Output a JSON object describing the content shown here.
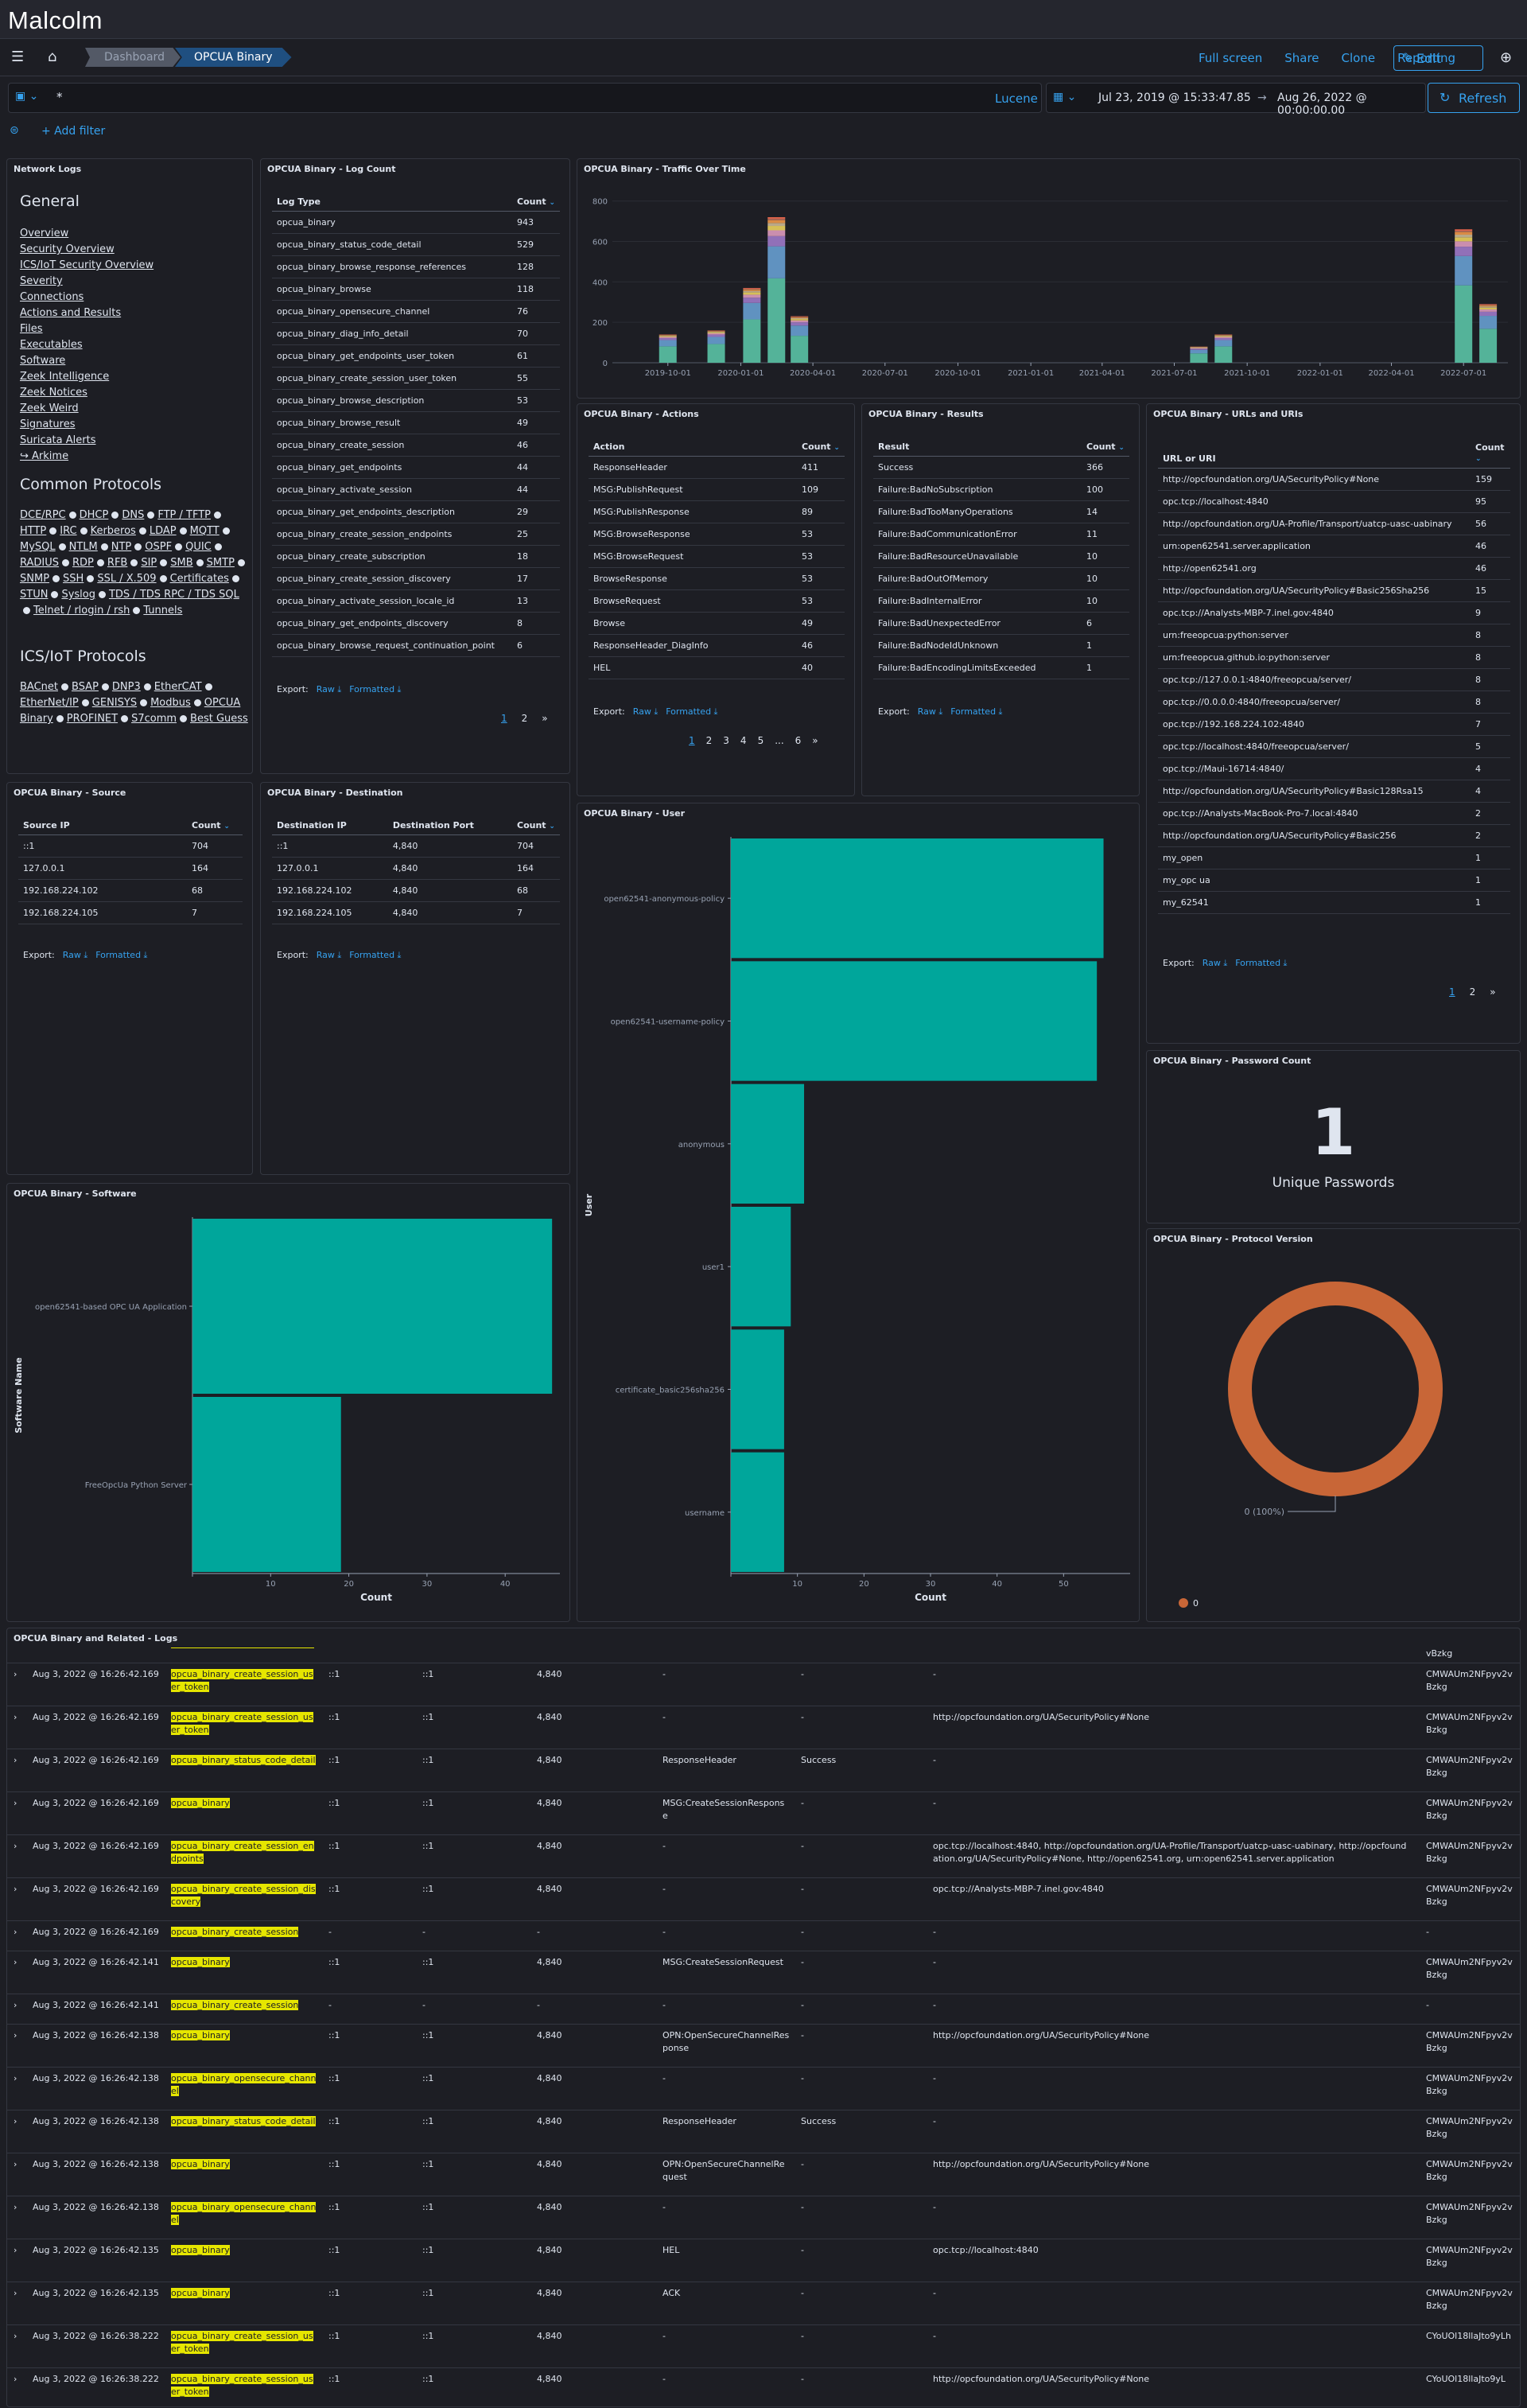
{
  "app": {
    "logo": "Malcolm"
  },
  "breadcrumbs": [
    "Dashboard",
    "OPCUA Binary"
  ],
  "top_links": [
    "Full screen",
    "Share",
    "Clone",
    "Reporting"
  ],
  "edit_label": "Edit",
  "query": {
    "type_icon": "calendar-db-icon",
    "text": "*",
    "language": "Lucene"
  },
  "time": {
    "start": "Jul 23, 2019 @ 15:33:47.85",
    "arrow": "→",
    "end": "Aug 26, 2022 @ 00:00:00.00",
    "refresh": "Refresh"
  },
  "add_filter": "+ Add filter",
  "network_logs": {
    "title": "Network Logs",
    "general_heading": "General",
    "general": [
      "Overview",
      "Security Overview",
      "ICS/IoT Security Overview",
      "Severity",
      "Connections",
      "Actions and Results",
      "Files",
      "Executables",
      "Software",
      "Zeek Intelligence",
      "Zeek Notices",
      "Zeek Weird",
      "Signatures",
      "Suricata Alerts",
      "↪ Arkime"
    ],
    "common_heading": "Common Protocols",
    "common": [
      "DCE/RPC",
      "DHCP",
      "DNS",
      "FTP / TFTP",
      "HTTP",
      "IRC",
      "Kerberos",
      "LDAP",
      "MQTT",
      "MySQL",
      "NTLM",
      "NTP",
      "OSPF",
      "QUIC",
      "RADIUS",
      "RDP",
      "RFB",
      "SIP",
      "SMB",
      "SMTP",
      "SNMP",
      "SSH",
      "SSL / X.509",
      "Certificates",
      "STUN",
      "Syslog",
      "TDS / TDS RPC / TDS SQL",
      "Telnet / rlogin / rsh",
      "Tunnels"
    ],
    "ics_heading": "ICS/IoT Protocols",
    "ics": [
      "BACnet",
      "BSAP",
      "DNP3",
      "EtherCAT",
      "EtherNet/IP",
      "GENISYS",
      "Modbus",
      "OPCUA Binary",
      "PROFINET",
      "S7comm",
      "Best Guess"
    ]
  },
  "log_count": {
    "title": "OPCUA Binary - Log Count",
    "headers": [
      "Log Type",
      "Count"
    ],
    "rows": [
      [
        "opcua_binary",
        "943"
      ],
      [
        "opcua_binary_status_code_detail",
        "529"
      ],
      [
        "opcua_binary_browse_response_references",
        "128"
      ],
      [
        "opcua_binary_browse",
        "118"
      ],
      [
        "opcua_binary_opensecure_channel",
        "76"
      ],
      [
        "opcua_binary_diag_info_detail",
        "70"
      ],
      [
        "opcua_binary_get_endpoints_user_token",
        "61"
      ],
      [
        "opcua_binary_create_session_user_token",
        "55"
      ],
      [
        "opcua_binary_browse_description",
        "53"
      ],
      [
        "opcua_binary_browse_result",
        "49"
      ],
      [
        "opcua_binary_create_session",
        "46"
      ],
      [
        "opcua_binary_get_endpoints",
        "44"
      ],
      [
        "opcua_binary_activate_session",
        "44"
      ],
      [
        "opcua_binary_get_endpoints_description",
        "29"
      ],
      [
        "opcua_binary_create_session_endpoints",
        "25"
      ],
      [
        "opcua_binary_create_subscription",
        "18"
      ],
      [
        "opcua_binary_create_session_discovery",
        "17"
      ],
      [
        "opcua_binary_activate_session_locale_id",
        "13"
      ],
      [
        "opcua_binary_get_endpoints_discovery",
        "8"
      ],
      [
        "opcua_binary_browse_request_continuation_point",
        "6"
      ]
    ],
    "pages": [
      "1",
      "2",
      "»"
    ]
  },
  "export": {
    "label": "Export:",
    "raw": "Raw",
    "formatted": "Formatted"
  },
  "traffic": {
    "title": "OPCUA Binary - Traffic Over Time"
  },
  "chart_data": [
    {
      "type": "bar",
      "title": "OPCUA Binary - Traffic Over Time",
      "stacked": true,
      "x_ticks": [
        "2019-10-01",
        "2020-01-01",
        "2020-04-01",
        "2020-07-01",
        "2020-10-01",
        "2021-01-01",
        "2021-04-01",
        "2021-07-01",
        "2021-10-01",
        "2022-01-01",
        "2022-04-01",
        "2022-07-01"
      ],
      "y_ticks": [
        "0",
        "200",
        "400",
        "600",
        "800"
      ],
      "ylim": [
        0,
        850
      ],
      "bars": [
        {
          "x": "2019-10-01",
          "total": 140
        },
        {
          "x": "2019-12-01",
          "total": 160
        },
        {
          "x": "2020-01-15",
          "total": 370
        },
        {
          "x": "2020-02-15",
          "total": 720
        },
        {
          "x": "2020-03-15",
          "total": 230
        },
        {
          "x": "2021-08-01",
          "total": 80
        },
        {
          "x": "2021-09-01",
          "total": 140
        },
        {
          "x": "2022-07-01",
          "total": 660
        },
        {
          "x": "2022-08-01",
          "total": 290
        }
      ]
    },
    {
      "type": "bar",
      "orientation": "horizontal",
      "title": "OPCUA Binary - User",
      "ylabel": "User",
      "xlabel": "Count",
      "categories": [
        "open62541-anonymous-policy",
        "open62541-username-policy",
        "anonymous",
        "user1",
        "certificate_basic256sha256",
        "username"
      ],
      "values": [
        56,
        55,
        11,
        9,
        8,
        8
      ],
      "x_ticks": [
        "0",
        "10",
        "20",
        "30",
        "40",
        "50"
      ],
      "xlim": [
        0,
        60
      ],
      "color": "#00a69b"
    },
    {
      "type": "bar",
      "orientation": "horizontal",
      "title": "OPCUA Binary - Software",
      "ylabel": "Software Name",
      "xlabel": "Count",
      "categories": [
        "open62541-based OPC UA Application",
        "FreeOpcUa Python Server"
      ],
      "values": [
        46,
        19
      ],
      "x_ticks": [
        "0",
        "10",
        "20",
        "30",
        "40"
      ],
      "xlim": [
        0,
        47
      ],
      "color": "#00a69b"
    },
    {
      "type": "pie",
      "title": "OPCUA Binary - Protocol Version",
      "donut": true,
      "slices": [
        {
          "label": "0",
          "value": 100,
          "color": "#c86637"
        }
      ],
      "slice_label": "0 (100%)",
      "legend": [
        "0"
      ]
    }
  ],
  "actions": {
    "title": "OPCUA Binary - Actions",
    "headers": [
      "Action",
      "Count"
    ],
    "rows": [
      [
        "ResponseHeader",
        "411"
      ],
      [
        "MSG:PublishRequest",
        "109"
      ],
      [
        "MSG:PublishResponse",
        "89"
      ],
      [
        "MSG:BrowseResponse",
        "53"
      ],
      [
        "MSG:BrowseRequest",
        "53"
      ],
      [
        "BrowseResponse",
        "53"
      ],
      [
        "BrowseRequest",
        "53"
      ],
      [
        "Browse",
        "49"
      ],
      [
        "ResponseHeader_DiagInfo",
        "46"
      ],
      [
        "HEL",
        "40"
      ]
    ],
    "pages": [
      "1",
      "2",
      "3",
      "4",
      "5",
      "...",
      "6",
      "»"
    ]
  },
  "results": {
    "title": "OPCUA Binary - Results",
    "headers": [
      "Result",
      "Count"
    ],
    "rows": [
      [
        "Success",
        "366"
      ],
      [
        "Failure:BadNoSubscription",
        "100"
      ],
      [
        "Failure:BadTooManyOperations",
        "14"
      ],
      [
        "Failure:BadCommunicationError",
        "11"
      ],
      [
        "Failure:BadResourceUnavailable",
        "10"
      ],
      [
        "Failure:BadOutOfMemory",
        "10"
      ],
      [
        "Failure:BadInternalError",
        "10"
      ],
      [
        "Failure:BadUnexpectedError",
        "6"
      ],
      [
        "Failure:BadNodeIdUnknown",
        "1"
      ],
      [
        "Failure:BadEncodingLimitsExceeded",
        "1"
      ]
    ]
  },
  "urls": {
    "title": "OPCUA Binary - URLs and URIs",
    "headers": [
      "URL or URI",
      "Count"
    ],
    "rows": [
      [
        "http://opcfoundation.org/UA/SecurityPolicy#None",
        "159"
      ],
      [
        "opc.tcp://localhost:4840",
        "95"
      ],
      [
        "http://opcfoundation.org/UA-Profile/Transport/uatcp-uasc-uabinary",
        "56"
      ],
      [
        "urn:open62541.server.application",
        "46"
      ],
      [
        "http://open62541.org",
        "46"
      ],
      [
        "http://opcfoundation.org/UA/SecurityPolicy#Basic256Sha256",
        "15"
      ],
      [
        "opc.tcp://Analysts-MBP-7.inel.gov:4840",
        "9"
      ],
      [
        "urn:freeopcua:python:server",
        "8"
      ],
      [
        "urn:freeopcua.github.io:python:server",
        "8"
      ],
      [
        "opc.tcp://127.0.0.1:4840/freeopcua/server/",
        "8"
      ],
      [
        "opc.tcp://0.0.0.0:4840/freeopcua/server/",
        "8"
      ],
      [
        "opc.tcp://192.168.224.102:4840",
        "7"
      ],
      [
        "opc.tcp://localhost:4840/freeopcua/server/",
        "5"
      ],
      [
        "opc.tcp://Maui-16714:4840/",
        "4"
      ],
      [
        "http://opcfoundation.org/UA/SecurityPolicy#Basic128Rsa15",
        "4"
      ],
      [
        "opc.tcp://Analysts-MacBook-Pro-7.local:4840",
        "2"
      ],
      [
        "http://opcfoundation.org/UA/SecurityPolicy#Basic256",
        "2"
      ],
      [
        "my_open",
        "1"
      ],
      [
        "my_opc ua",
        "1"
      ],
      [
        "my_62541",
        "1"
      ]
    ],
    "pages": [
      "1",
      "2",
      "»"
    ]
  },
  "source": {
    "title": "OPCUA Binary - Source",
    "headers": [
      "Source IP",
      "Count"
    ],
    "rows": [
      [
        "::1",
        "704"
      ],
      [
        "127.0.0.1",
        "164"
      ],
      [
        "192.168.224.102",
        "68"
      ],
      [
        "192.168.224.105",
        "7"
      ]
    ]
  },
  "destination": {
    "title": "OPCUA Binary - Destination",
    "headers": [
      "Destination IP",
      "Destination Port",
      "Count"
    ],
    "rows": [
      [
        "::1",
        "4,840",
        "704"
      ],
      [
        "127.0.0.1",
        "4,840",
        "164"
      ],
      [
        "192.168.224.102",
        "4,840",
        "68"
      ],
      [
        "192.168.224.105",
        "4,840",
        "7"
      ]
    ]
  },
  "user": {
    "title": "OPCUA Binary - User"
  },
  "password": {
    "title": "OPCUA Binary - Password Count",
    "value": "1",
    "label": "Unique Passwords"
  },
  "protocol": {
    "title": "OPCUA Binary - Protocol Version"
  },
  "software": {
    "title": "OPCUA Binary - Software"
  },
  "logs": {
    "title": "OPCUA Binary and Related - Logs",
    "rows": [
      {
        "time": "",
        "type": "",
        "src": "",
        "dst": "",
        "port": "",
        "action": "",
        "result": "",
        "uri": "",
        "uid": "vBzkg"
      },
      {
        "time": "Aug 3, 2022 @ 16:26:42.169",
        "type": "opcua_binary_create_session_user_token",
        "src": "::1",
        "dst": "::1",
        "port": "4,840",
        "action": "-",
        "result": "-",
        "uri": "-",
        "uid": "CMWAUm2NFpyv2vBzkg"
      },
      {
        "time": "Aug 3, 2022 @ 16:26:42.169",
        "type": "opcua_binary_create_session_user_token",
        "src": "::1",
        "dst": "::1",
        "port": "4,840",
        "action": "-",
        "result": "-",
        "uri": "http://opcfoundation.org/UA/SecurityPolicy#None",
        "uid": "CMWAUm2NFpyv2vBzkg"
      },
      {
        "time": "Aug 3, 2022 @ 16:26:42.169",
        "type": "opcua_binary_status_code_detail",
        "src": "::1",
        "dst": "::1",
        "port": "4,840",
        "action": "ResponseHeader",
        "result": "Success",
        "uri": "-",
        "uid": "CMWAUm2NFpyv2vBzkg"
      },
      {
        "time": "Aug 3, 2022 @ 16:26:42.169",
        "type": "opcua_binary",
        "src": "::1",
        "dst": "::1",
        "port": "4,840",
        "action": "MSG:CreateSessionResponse",
        "result": "-",
        "uri": "-",
        "uid": "CMWAUm2NFpyv2vBzkg"
      },
      {
        "time": "Aug 3, 2022 @ 16:26:42.169",
        "type": "opcua_binary_create_session_endpoints",
        "src": "::1",
        "dst": "::1",
        "port": "4,840",
        "action": "-",
        "result": "-",
        "uri": "opc.tcp://localhost:4840, http://opcfoundation.org/UA-Profile/Transport/uatcp-uasc-uabinary, http://opcfoundation.org/UA/SecurityPolicy#None, http://open62541.org, urn:open62541.server.application",
        "uid": "CMWAUm2NFpyv2vBzkg"
      },
      {
        "time": "Aug 3, 2022 @ 16:26:42.169",
        "type": "opcua_binary_create_session_discovery",
        "src": "::1",
        "dst": "::1",
        "port": "4,840",
        "action": "-",
        "result": "-",
        "uri": "opc.tcp://Analysts-MBP-7.inel.gov:4840",
        "uid": "CMWAUm2NFpyv2vBzkg"
      },
      {
        "time": "Aug 3, 2022 @ 16:26:42.169",
        "type": "opcua_binary_create_session",
        "src": "-",
        "dst": "-",
        "port": "-",
        "action": "-",
        "result": "-",
        "uri": "-",
        "uid": "-"
      },
      {
        "time": "Aug 3, 2022 @ 16:26:42.141",
        "type": "opcua_binary",
        "src": "::1",
        "dst": "::1",
        "port": "4,840",
        "action": "MSG:CreateSessionRequest",
        "result": "-",
        "uri": "-",
        "uid": "CMWAUm2NFpyv2vBzkg"
      },
      {
        "time": "Aug 3, 2022 @ 16:26:42.141",
        "type": "opcua_binary_create_session",
        "src": "-",
        "dst": "-",
        "port": "-",
        "action": "-",
        "result": "-",
        "uri": "-",
        "uid": "-"
      },
      {
        "time": "Aug 3, 2022 @ 16:26:42.138",
        "type": "opcua_binary",
        "src": "::1",
        "dst": "::1",
        "port": "4,840",
        "action": "OPN:OpenSecureChannelResponse",
        "result": "-",
        "uri": "http://opcfoundation.org/UA/SecurityPolicy#None",
        "uid": "CMWAUm2NFpyv2vBzkg"
      },
      {
        "time": "Aug 3, 2022 @ 16:26:42.138",
        "type": "opcua_binary_opensecure_channel",
        "src": "::1",
        "dst": "::1",
        "port": "4,840",
        "action": "-",
        "result": "-",
        "uri": "-",
        "uid": "CMWAUm2NFpyv2vBzkg"
      },
      {
        "time": "Aug 3, 2022 @ 16:26:42.138",
        "type": "opcua_binary_status_code_detail",
        "src": "::1",
        "dst": "::1",
        "port": "4,840",
        "action": "ResponseHeader",
        "result": "Success",
        "uri": "-",
        "uid": "CMWAUm2NFpyv2vBzkg"
      },
      {
        "time": "Aug 3, 2022 @ 16:26:42.138",
        "type": "opcua_binary",
        "src": "::1",
        "dst": "::1",
        "port": "4,840",
        "action": "OPN:OpenSecureChannelRequest",
        "result": "-",
        "uri": "http://opcfoundation.org/UA/SecurityPolicy#None",
        "uid": "CMWAUm2NFpyv2vBzkg"
      },
      {
        "time": "Aug 3, 2022 @ 16:26:42.138",
        "type": "opcua_binary_opensecure_channel",
        "src": "::1",
        "dst": "::1",
        "port": "4,840",
        "action": "-",
        "result": "-",
        "uri": "-",
        "uid": "CMWAUm2NFpyv2vBzkg"
      },
      {
        "time": "Aug 3, 2022 @ 16:26:42.135",
        "type": "opcua_binary",
        "src": "::1",
        "dst": "::1",
        "port": "4,840",
        "action": "HEL",
        "result": "-",
        "uri": "opc.tcp://localhost:4840",
        "uid": "CMWAUm2NFpyv2vBzkg"
      },
      {
        "time": "Aug 3, 2022 @ 16:26:42.135",
        "type": "opcua_binary",
        "src": "::1",
        "dst": "::1",
        "port": "4,840",
        "action": "ACK",
        "result": "-",
        "uri": "-",
        "uid": "CMWAUm2NFpyv2vBzkg"
      },
      {
        "time": "Aug 3, 2022 @ 16:26:38.222",
        "type": "opcua_binary_create_session_user_token",
        "src": "::1",
        "dst": "::1",
        "port": "4,840",
        "action": "-",
        "result": "-",
        "uri": "-",
        "uid": "CYoUOl18llaJto9yLh"
      },
      {
        "time": "Aug 3, 2022 @ 16:26:38.222",
        "type": "opcua_binary_create_session_user_token",
        "src": "::1",
        "dst": "::1",
        "port": "4,840",
        "action": "-",
        "result": "-",
        "uri": "http://opcfoundation.org/UA/SecurityPolicy#None",
        "uid": "CYoUOl18llaJto9yL"
      }
    ]
  }
}
